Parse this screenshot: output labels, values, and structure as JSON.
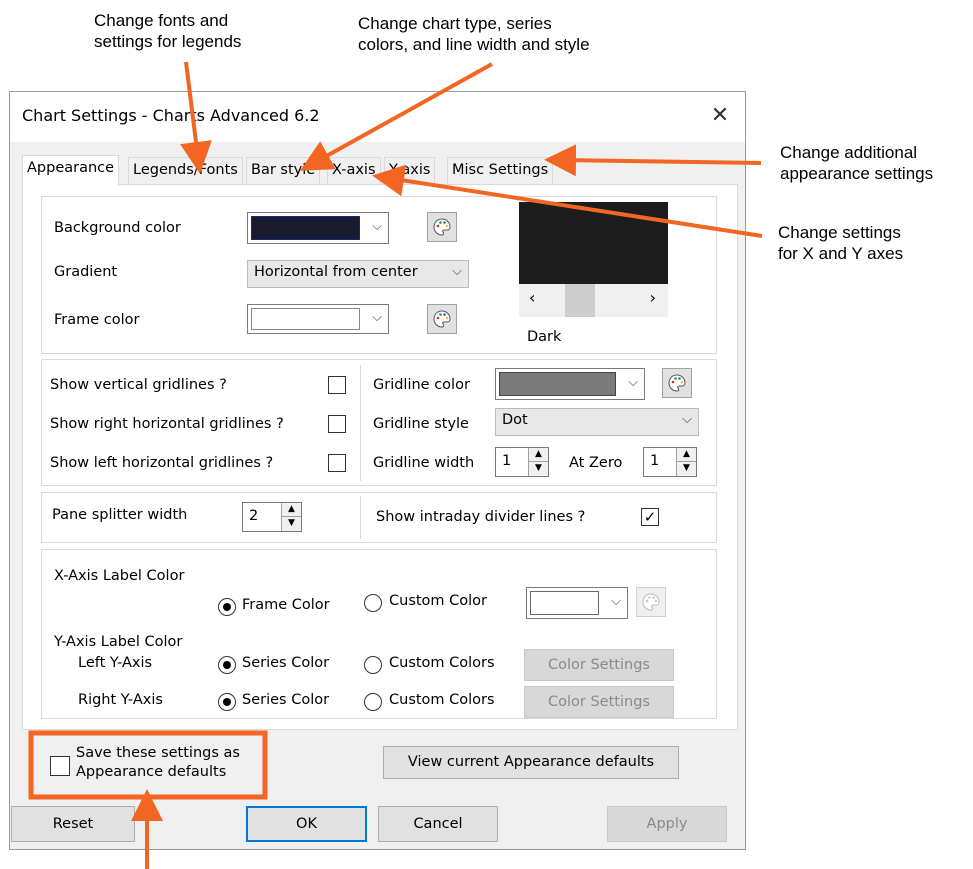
{
  "annotations": {
    "fonts": [
      "Change fonts and",
      "settings for legends"
    ],
    "chart_type": [
      "Change chart type, series",
      "colors, and line width and style"
    ],
    "additional": [
      "Change additional",
      "appearance settings"
    ],
    "axes": [
      "Change settings",
      "for X and Y axes"
    ]
  },
  "window": {
    "title": "Chart Settings - Charts Advanced 6.2",
    "close_glyph": "✕"
  },
  "tabs": [
    {
      "label": "Appearance",
      "active": true
    },
    {
      "label": "Legends/Fonts"
    },
    {
      "label": "Bar style"
    },
    {
      "label": "X-axis"
    },
    {
      "label": "Y-axis"
    },
    {
      "label": "Misc Settings"
    }
  ],
  "background": {
    "bg_label": "Background color",
    "bg_color": "#1a1a2e",
    "gradient_label": "Gradient",
    "gradient_value": "Horizontal from center",
    "frame_label": "Frame color",
    "frame_color": "#ffffff",
    "scheme_name": "Dark",
    "prev_glyph": "‹",
    "next_glyph": "›"
  },
  "gridlines": {
    "show_vertical": "Show vertical gridlines ?",
    "show_right": "Show right horizontal gridlines ?",
    "show_left": "Show left horizontal gridlines ?",
    "color_label": "Gridline color",
    "color_value": "#7a7a7a",
    "style_label": "Gridline style",
    "style_value": "Dot",
    "width_label": "Gridline width",
    "width_value": "1",
    "at_zero_label": "At Zero",
    "at_zero_value": "1"
  },
  "splitter": {
    "label": "Pane splitter width",
    "value": "2",
    "intraday_label": "Show intraday divider lines ?",
    "intraday_mark": "✓"
  },
  "axis_colors": {
    "x_header": "X-Axis Label Color",
    "x_frame": "Frame Color",
    "x_custom": "Custom Color",
    "y_header": "Y-Axis Label Color",
    "left": "Left Y-Axis",
    "right": "Right Y-Axis",
    "series": "Series Color",
    "custom_colors": "Custom Colors",
    "color_settings": "Color Settings"
  },
  "defaults": {
    "save_line1": "Save these settings as",
    "save_line2": "Appearance defaults",
    "view_button": "View current Appearance defaults"
  },
  "buttons": {
    "reset": "Reset",
    "ok": "OK",
    "cancel": "Cancel",
    "apply": "Apply"
  },
  "colors": {
    "accent_orange": "#f26522",
    "focus_blue": "#0078d7"
  },
  "caret_glyph": "⌵",
  "up_glyph": "▲",
  "down_glyph": "▼"
}
